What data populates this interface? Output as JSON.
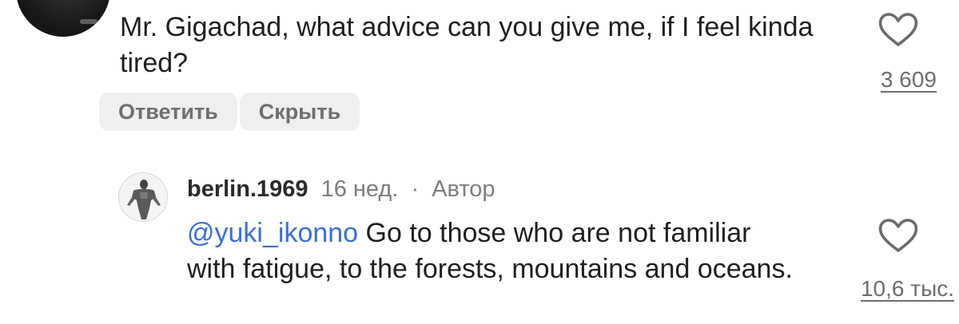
{
  "top_comment": {
    "text": "Mr. Gigachad, what advice can you give me, if I feel kinda tired?",
    "like_count": "3 609",
    "actions": {
      "reply_label": "Ответить",
      "hide_label": "Скрыть"
    }
  },
  "reply": {
    "author": "berlin.1969",
    "time": "16 нед.",
    "separator": "·",
    "badge": "Автор",
    "mention": "@yuki_ikonno",
    "text": "Go to those who are not familiar with fatigue, to the forests, mountains and oceans.",
    "like_count": "10,6 тыс."
  },
  "icons": {
    "like": "heart-outline-icon"
  },
  "colors": {
    "mention": "#3b6fd8",
    "muted_text": "#7d7d7d",
    "chip_bg": "#efeff1"
  }
}
